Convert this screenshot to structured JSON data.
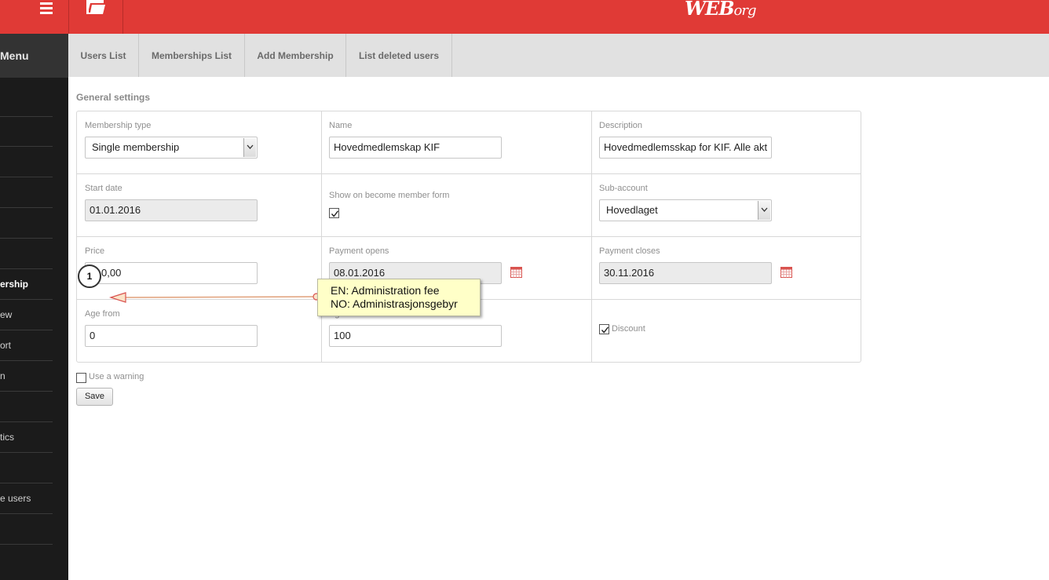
{
  "header": {
    "logo_main": "WEB",
    "logo_suffix": "org",
    "menu_icon": "hamburger-icon",
    "folder_icon": "folder-icon"
  },
  "colors": {
    "brand": "#e03a36",
    "sidebar_bg": "#1b1b1b",
    "tab_bg": "#e1e1e1",
    "tooltip_bg": "#ffffc8"
  },
  "sidebar": {
    "title": "Menu",
    "items": [
      {
        "label": ""
      },
      {
        "label": ""
      },
      {
        "label": ""
      },
      {
        "label": ""
      },
      {
        "label": ""
      },
      {
        "label": ""
      },
      {
        "label": "ership"
      },
      {
        "label": "ew"
      },
      {
        "label": "ort"
      },
      {
        "label": "n"
      },
      {
        "label": ""
      },
      {
        "label": "tics"
      },
      {
        "label": ""
      },
      {
        "label": "e users"
      },
      {
        "label": ""
      },
      {
        "label": ""
      }
    ]
  },
  "tabs": [
    {
      "label": "Users List"
    },
    {
      "label": "Memberships List"
    },
    {
      "label": "Add Membership"
    },
    {
      "label": "List deleted users"
    }
  ],
  "section_title": "General settings",
  "form": {
    "membership_type": {
      "label": "Membership type",
      "value": "Single membership"
    },
    "name": {
      "label": "Name",
      "value": "Hovedmedlemskap KIF"
    },
    "description": {
      "label": "Description",
      "value": "Hovedmedlemsskap for KIF. Alle akt"
    },
    "start_date": {
      "label": "Start date",
      "value": "01.01.2016"
    },
    "show_on_form": {
      "label": "Show on become member form",
      "checked": true
    },
    "sub_account": {
      "label": "Sub-account",
      "value": "Hovedlaget"
    },
    "price": {
      "label": "Price",
      "value": "0,00"
    },
    "payment_opens": {
      "label": "Payment opens",
      "value": "08.01.2016"
    },
    "payment_closes": {
      "label": "Payment closes",
      "value": "30.11.2016"
    },
    "age_from": {
      "label": "Age from",
      "value": "0"
    },
    "age_to": {
      "label": "Age to",
      "value": "100"
    },
    "discount": {
      "label": "Discount",
      "checked": true
    }
  },
  "use_warning": {
    "label": "Use a warning",
    "checked": false
  },
  "save_label": "Save",
  "annotation": {
    "step": "1",
    "line_en": "EN: Administration fee",
    "line_no": "NO: Administrasjonsgebyr"
  }
}
